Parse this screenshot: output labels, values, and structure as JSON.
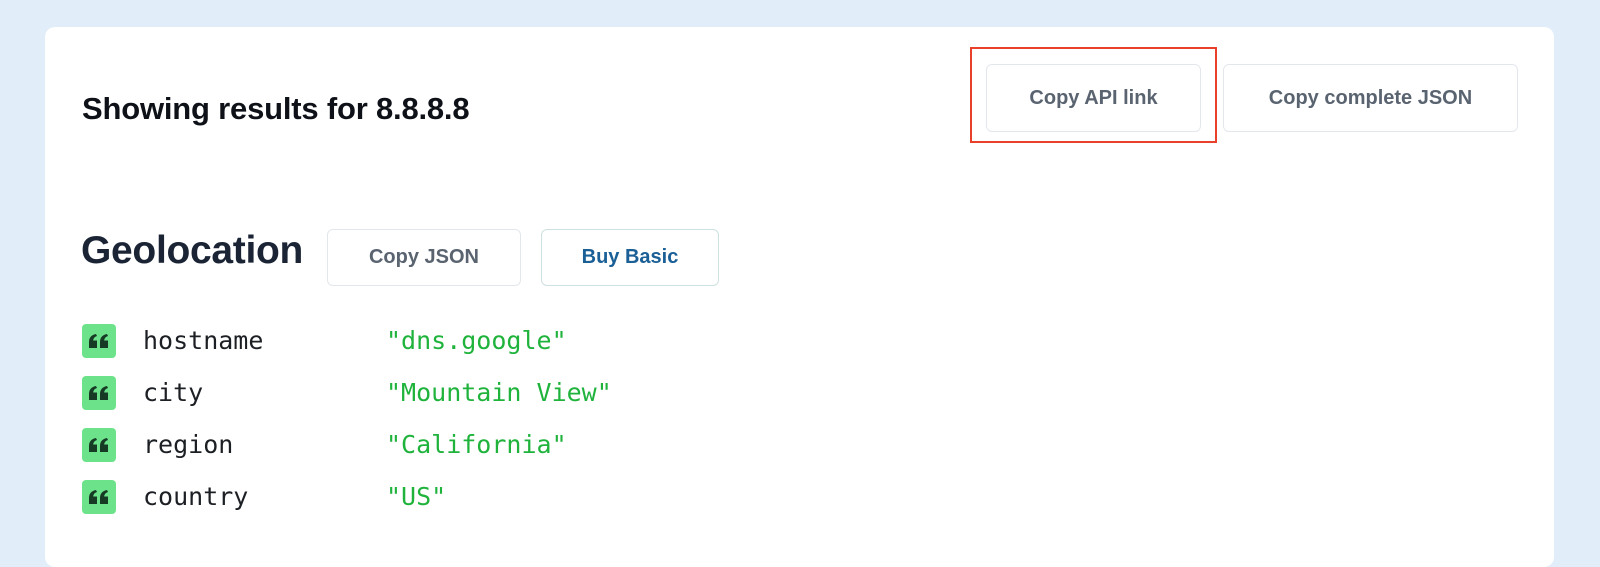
{
  "header": {
    "results_prefix": "Showing results for",
    "ip": "8.8.8.8",
    "copy_api_link_label": "Copy API link",
    "copy_complete_json_label": "Copy complete JSON"
  },
  "geolocation": {
    "title": "Geolocation",
    "copy_json_label": "Copy JSON",
    "buy_basic_label": "Buy Basic",
    "fields": [
      {
        "key": "hostname",
        "value": "\"dns.google\""
      },
      {
        "key": "city",
        "value": "\"Mountain View\""
      },
      {
        "key": "region",
        "value": "\"California\""
      },
      {
        "key": "country",
        "value": "\"US\""
      }
    ]
  },
  "colors": {
    "page_background": "#e1eef9",
    "card_background": "#ffffff",
    "highlight": "#e9402b",
    "string_value": "#1fb33c",
    "quote_badge": "#6ce38a",
    "buy_link": "#1a5f96"
  },
  "icons": {
    "field_type": "quote-icon"
  }
}
